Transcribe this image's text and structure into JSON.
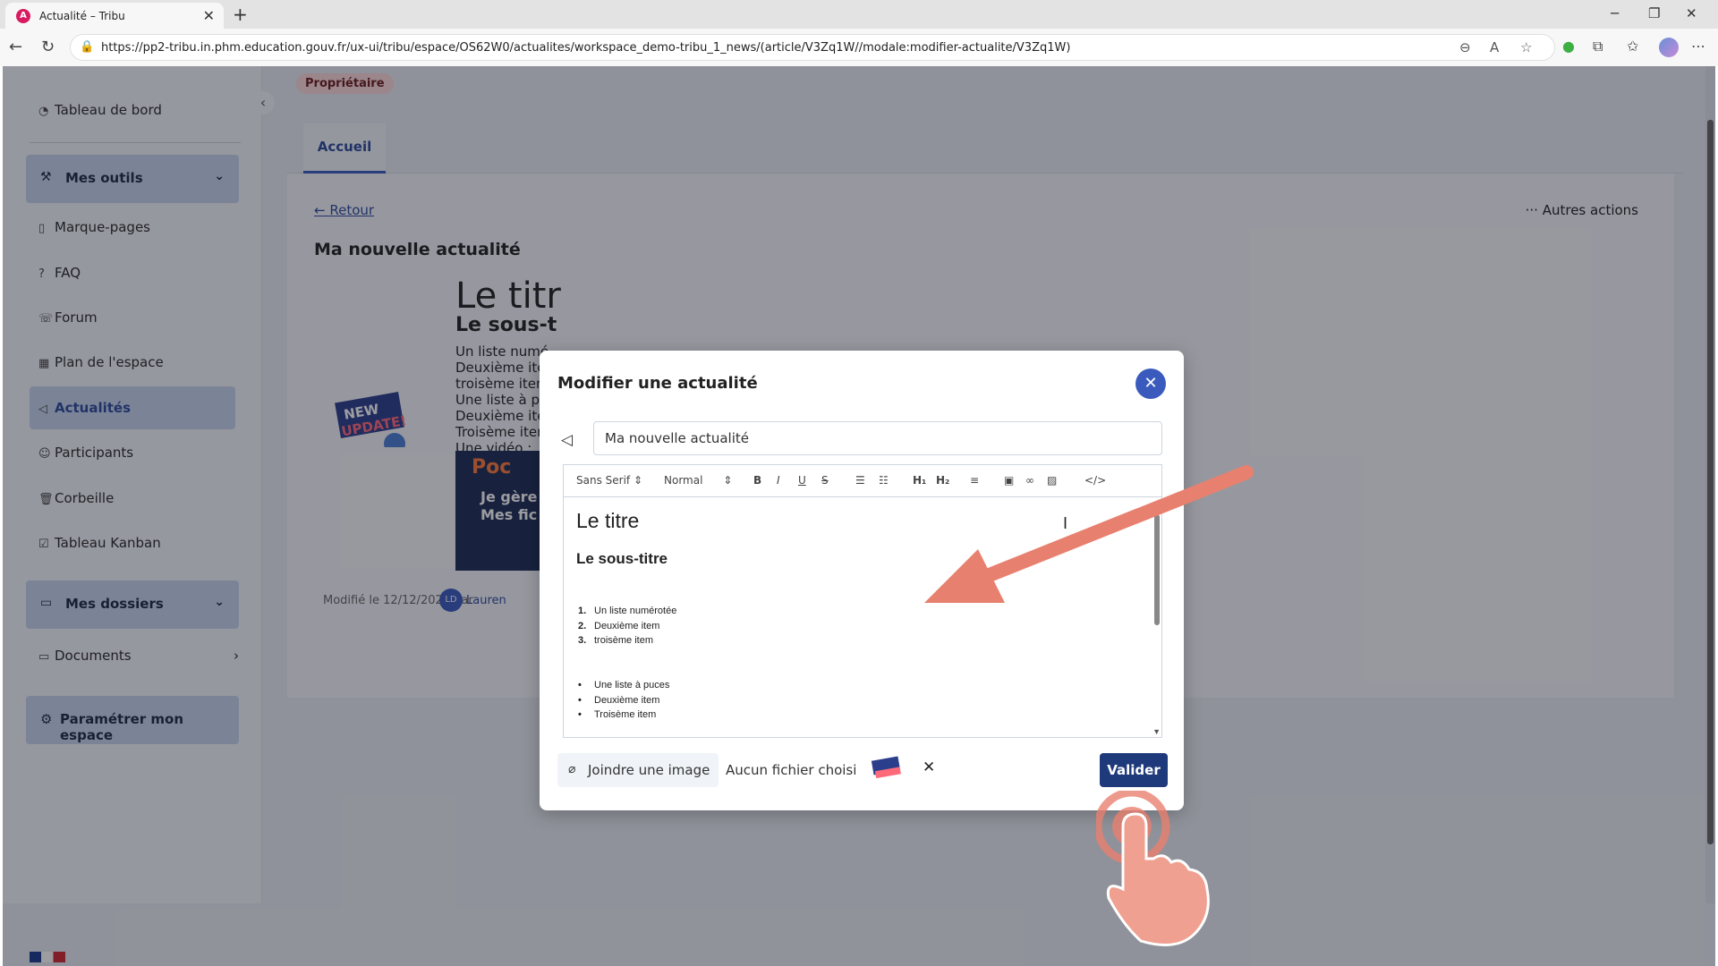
{
  "browser": {
    "tab_title": "Actualité – Tribu",
    "url": "https://pp2-tribu.in.phm.education.gouv.fr/ux-ui/tribu/espace/OS62W0/actualites/workspace_demo-tribu_1_news/(article/V3Zq1W//modale:modifier-actualite/V3Zq1W)",
    "icons": [
      "back-icon",
      "reload-icon",
      "lock-icon",
      "zoom-out-icon",
      "read-aloud-icon",
      "favorite-icon",
      "extension-icon",
      "collections-icon",
      "profile-icon",
      "more-icon"
    ]
  },
  "sidebar": {
    "dashboard": "Tableau de bord",
    "tools_group": "Mes outils",
    "items": [
      {
        "label": "Marque-pages",
        "icon": "bookmark-icon"
      },
      {
        "label": "FAQ",
        "icon": "help-icon"
      },
      {
        "label": "Forum",
        "icon": "forum-icon"
      },
      {
        "label": "Plan de l'espace",
        "icon": "map-icon"
      },
      {
        "label": "Actualités",
        "icon": "megaphone-icon"
      },
      {
        "label": "Participants",
        "icon": "participants-icon"
      },
      {
        "label": "Corbeille",
        "icon": "trash-icon"
      },
      {
        "label": "Tableau Kanban",
        "icon": "kanban-icon"
      }
    ],
    "folders_group": "Mes dossiers",
    "documents": "Documents",
    "settings_button": "Paramétrer mon espace"
  },
  "main": {
    "owner_badge": "Propriétaire",
    "tab_home": "Accueil",
    "back_link": "Retour",
    "other_actions": "Autres actions",
    "article_title": "Ma nouvelle actualité",
    "article_h1": "Le titr",
    "article_h2": "Le sous-t",
    "article_lines": [
      "Un liste numé",
      "Deuxième ite",
      "troisème iten",
      "Une liste à pu",
      "Deuxième ite",
      "Troisème iter",
      "Une vidéo :"
    ],
    "video_text_line1": "Je gère",
    "video_text_line2": "Mes fic",
    "video_brand": "Poc",
    "meta": "Modifié le 12/12/2025 par",
    "author_initials": "LD",
    "author": "Lauren"
  },
  "modal": {
    "title": "Modifier une actualité",
    "title_value": "Ma nouvelle actualité",
    "toolbar": {
      "font": "Sans Serif",
      "size": "Normal",
      "bold": "B",
      "italic": "I",
      "underline": "U",
      "strike": "S",
      "h1": "H₁",
      "h2": "H₂",
      "code": "</>"
    },
    "editor": {
      "h1": "Le titre",
      "h2": "Le sous-titre",
      "ordered": [
        {
          "n": "1.",
          "t": "Un liste numérotée"
        },
        {
          "n": "2.",
          "t": "Deuxième item"
        },
        {
          "n": "3.",
          "t": "troisème item"
        }
      ],
      "bullets": [
        "Une liste à puces",
        "Deuxième item",
        "Troisème item"
      ]
    },
    "attach_button": "Joindre une image",
    "no_file": "Aucun fichier choisi",
    "validate_button": "Valider"
  },
  "colors": {
    "accent": "#3a5bbd",
    "validate": "#1f3a7a",
    "annotation": "#e8806f"
  }
}
